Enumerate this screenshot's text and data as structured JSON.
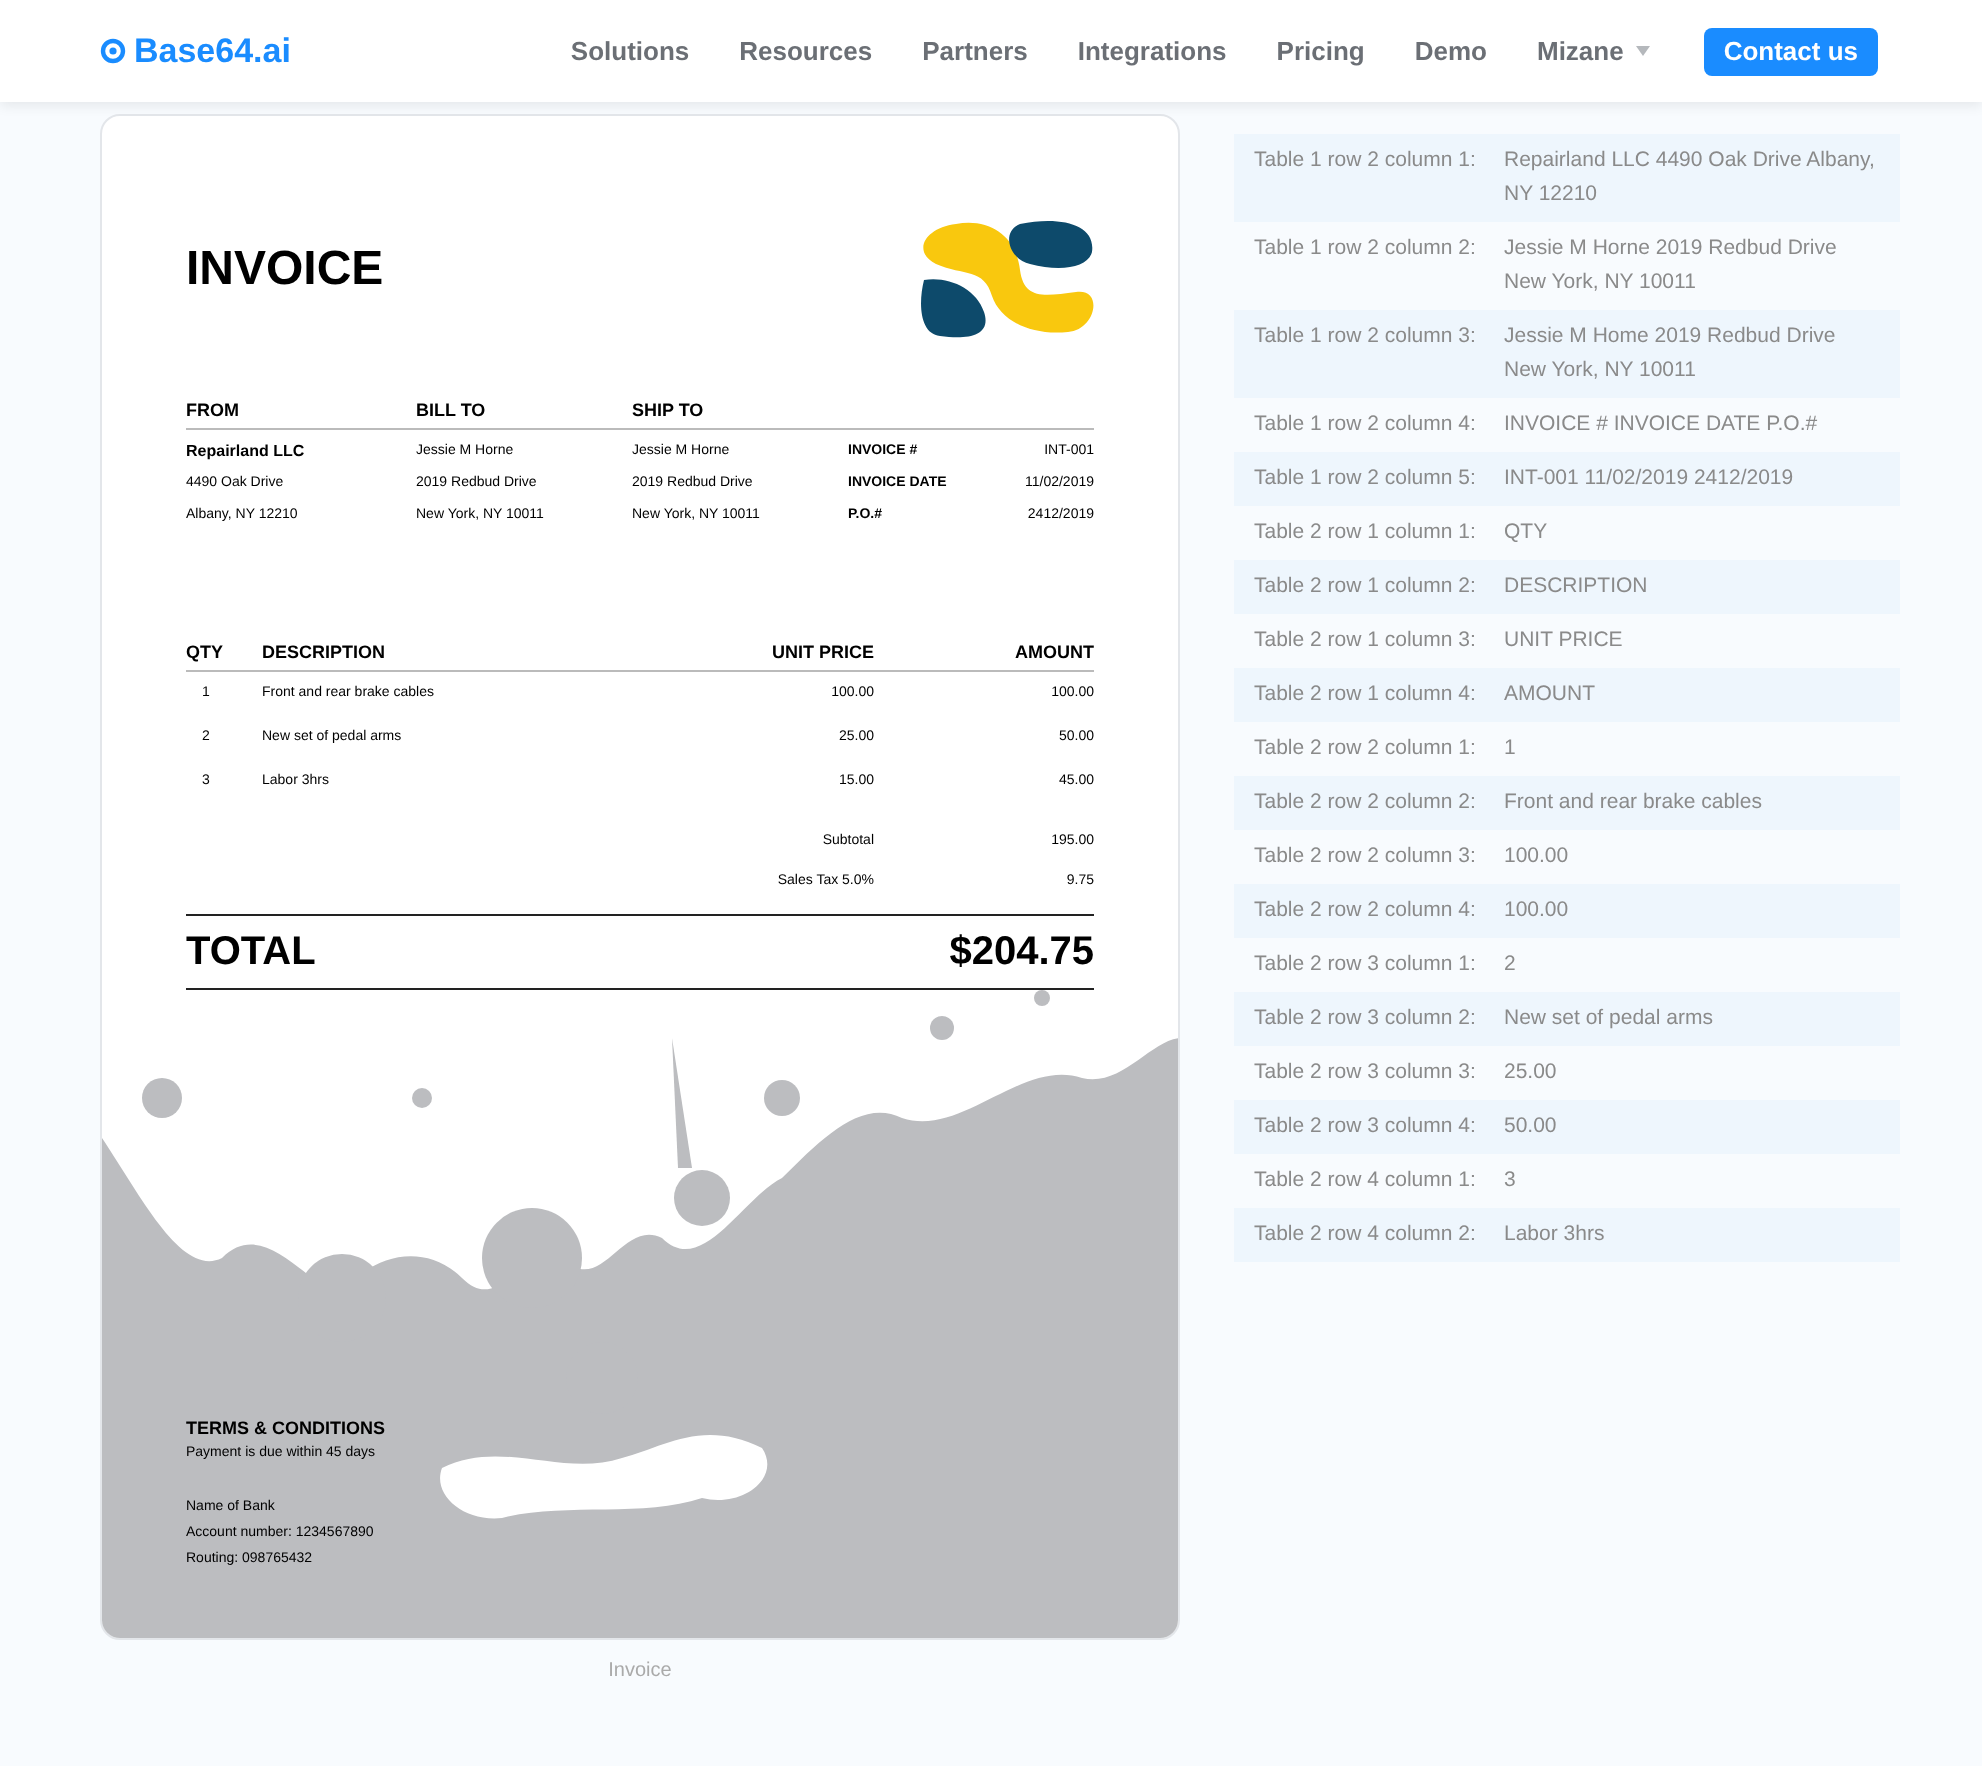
{
  "nav": {
    "logo": "Base64.ai",
    "links": [
      {
        "label": "Solutions",
        "dropdown": false
      },
      {
        "label": "Resources",
        "dropdown": false
      },
      {
        "label": "Partners",
        "dropdown": false
      },
      {
        "label": "Integrations",
        "dropdown": false
      },
      {
        "label": "Pricing",
        "dropdown": false
      },
      {
        "label": "Demo",
        "dropdown": false
      },
      {
        "label": "Mizane",
        "dropdown": true
      }
    ],
    "cta": "Contact us"
  },
  "invoice": {
    "title": "INVOICE",
    "parties": [
      {
        "heading": "FROM",
        "lines": [
          "Repairland LLC",
          "4490 Oak Drive",
          "Albany, NY 12210"
        ]
      },
      {
        "heading": "BILL TO",
        "lines": [
          "Jessie M Horne",
          "2019 Redbud Drive",
          "New York, NY 10011"
        ]
      },
      {
        "heading": "SHIP TO",
        "lines": [
          "Jessie M Horne",
          "2019 Redbud Drive",
          "New York, NY 10011"
        ]
      }
    ],
    "meta": [
      {
        "label": "INVOICE #",
        "value": "INT-001"
      },
      {
        "label": "INVOICE DATE",
        "value": "11/02/2019"
      },
      {
        "label": "P.O.#",
        "value": "2412/2019"
      }
    ],
    "columns": [
      "QTY",
      "DESCRIPTION",
      "UNIT PRICE",
      "AMOUNT"
    ],
    "items": [
      {
        "qty": "1",
        "description": "Front and rear brake cables",
        "unit_price": "100.00",
        "amount": "100.00"
      },
      {
        "qty": "2",
        "description": "New set of pedal arms",
        "unit_price": "25.00",
        "amount": "50.00"
      },
      {
        "qty": "3",
        "description": "Labor 3hrs",
        "unit_price": "15.00",
        "amount": "45.00"
      }
    ],
    "summary": [
      {
        "label": "Subtotal",
        "value": "195.00"
      },
      {
        "label": "Sales Tax 5.0%",
        "value": "9.75"
      }
    ],
    "total_label": "TOTAL",
    "total": "$204.75",
    "terms_heading": "TERMS & CONDITIONS",
    "terms": "Payment is due within 45 days",
    "bank": [
      "Name of Bank",
      "Account number: 1234567890",
      "Routing: 098765432"
    ]
  },
  "caption": "Invoice",
  "results": {
    "rows": [
      {
        "label": "Table 1 row 2 column 1:",
        "value": "Repairland LLC 4490 Oak Drive Albany, NY 12210"
      },
      {
        "label": "Table 1 row 2 column 2:",
        "value": "Jessie M Horne 2019 Redbud Drive New York, NY 10011"
      },
      {
        "label": "Table 1 row 2 column 3:",
        "value": "Jessie M Home 2019 Redbud Drive New York, NY 10011"
      },
      {
        "label": "Table 1 row 2 column 4:",
        "value": "INVOICE # INVOICE DATE P.O.#"
      },
      {
        "label": "Table 1 row 2 column 5:",
        "value": "INT-001 11/02/2019 2412/2019"
      },
      {
        "label": "Table 2 row 1 column 1:",
        "value": "QTY"
      },
      {
        "label": "Table 2 row 1 column 2:",
        "value": "DESCRIPTION"
      },
      {
        "label": "Table 2 row 1 column 3:",
        "value": "UNIT PRICE"
      },
      {
        "label": "Table 2 row 1 column 4:",
        "value": "AMOUNT"
      },
      {
        "label": "Table 2 row 2 column 1:",
        "value": "1"
      },
      {
        "label": "Table 2 row 2 column 2:",
        "value": "Front and rear brake cables"
      },
      {
        "label": "Table 2 row 2 column 3:",
        "value": "100.00"
      },
      {
        "label": "Table 2 row 2 column 4:",
        "value": "100.00"
      },
      {
        "label": "Table 2 row 3 column 1:",
        "value": "2"
      },
      {
        "label": "Table 2 row 3 column 2:",
        "value": "New set of pedal arms"
      },
      {
        "label": "Table 2 row 3 column 3:",
        "value": "25.00"
      },
      {
        "label": "Table 2 row 3 column 4:",
        "value": "50.00"
      },
      {
        "label": "Table 2 row 4 column 1:",
        "value": "3"
      },
      {
        "label": "Table 2 row 4 column 2:",
        "value": "Labor 3hrs"
      }
    ]
  }
}
